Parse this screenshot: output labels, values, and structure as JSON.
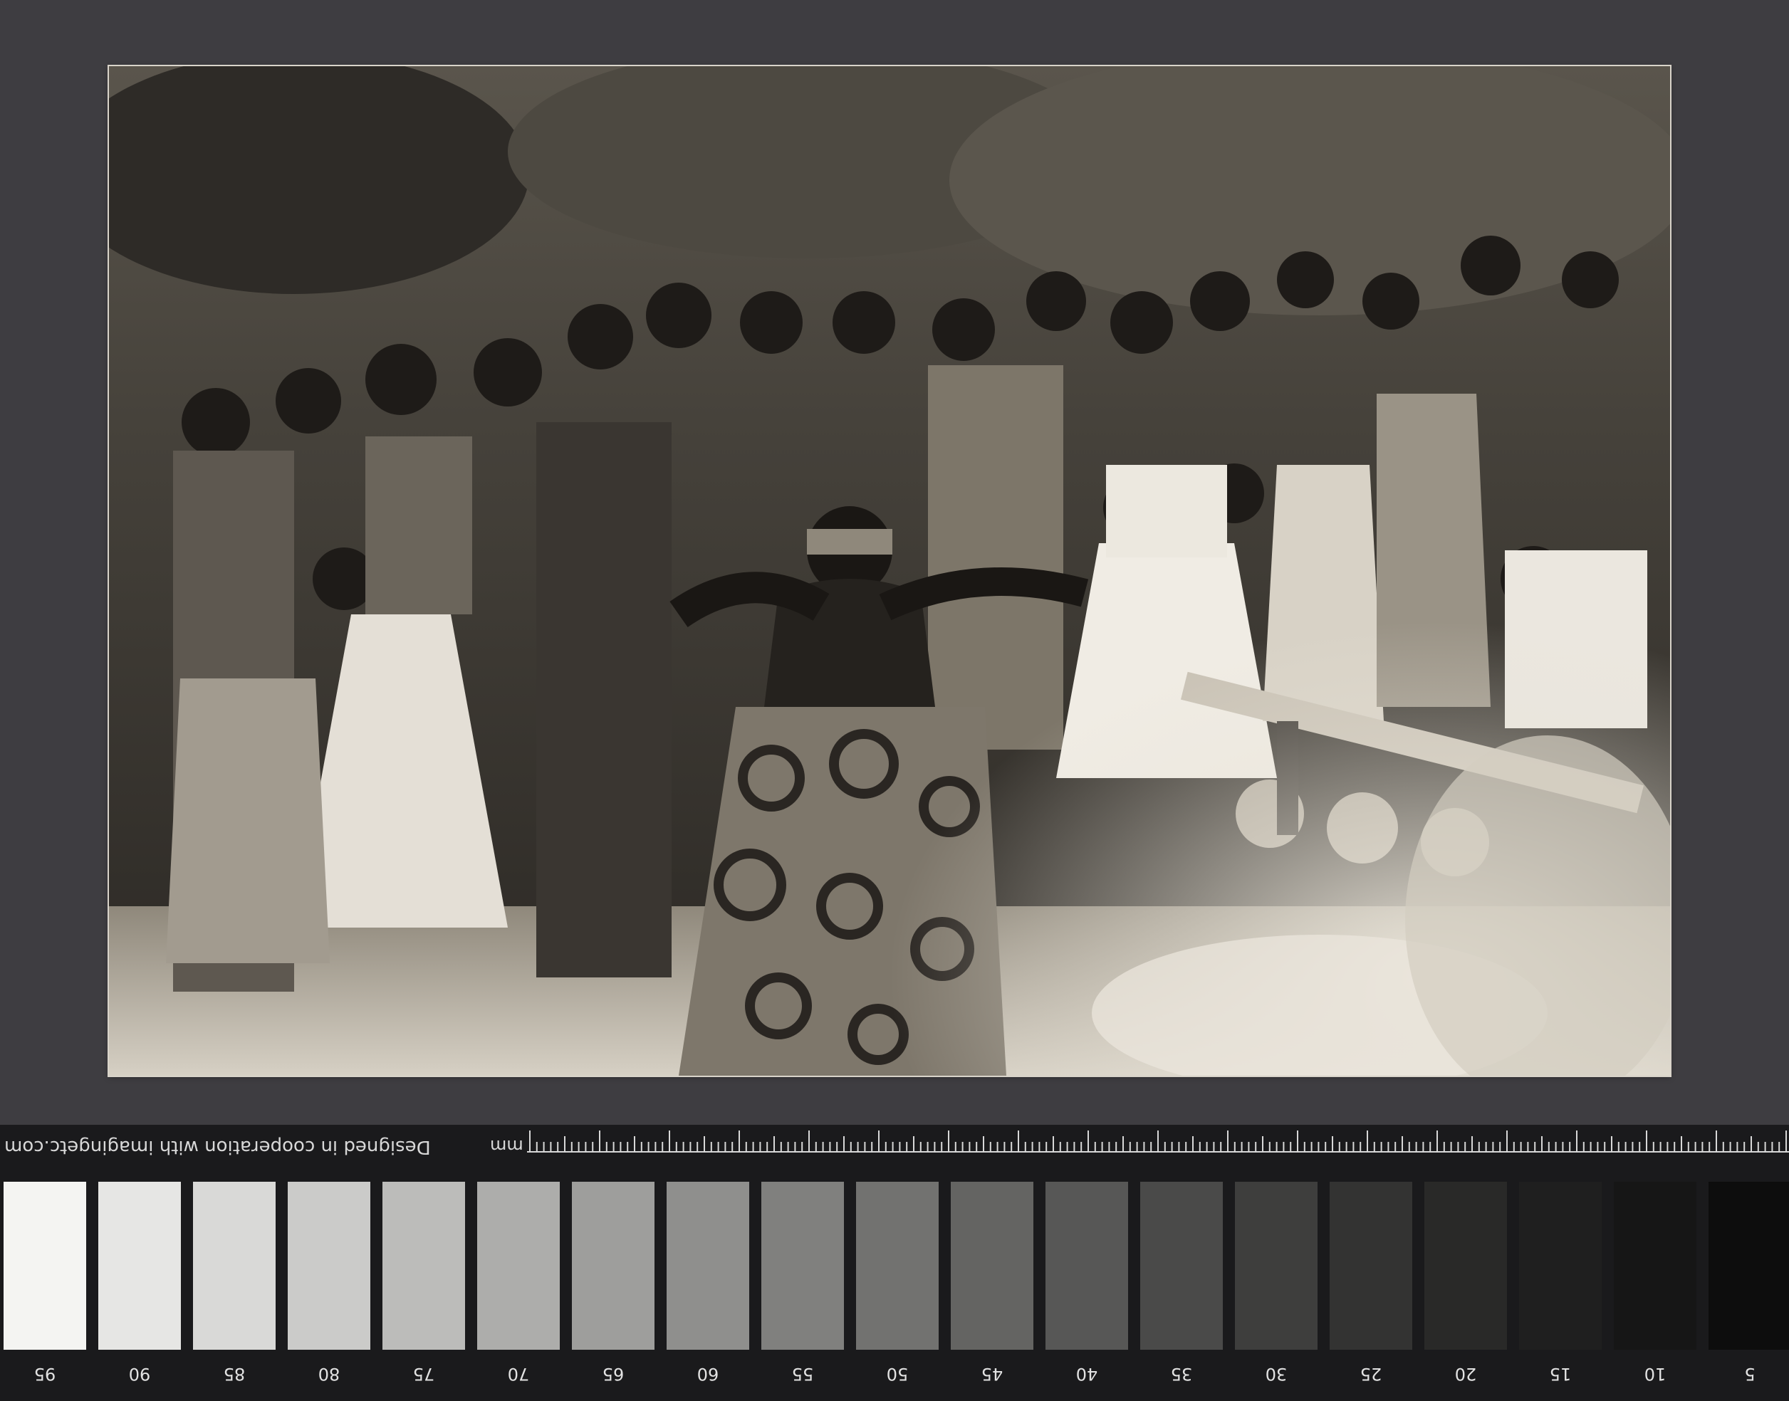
{
  "target": {
    "credit_text": "Designed in cooperation with imagingetc.com",
    "unit_label": "mm",
    "patches": [
      {
        "label": "95",
        "color": "#f4f4f2"
      },
      {
        "label": "90",
        "color": "#e6e6e4"
      },
      {
        "label": "85",
        "color": "#d9d9d7"
      },
      {
        "label": "80",
        "color": "#cbcbc9"
      },
      {
        "label": "75",
        "color": "#bcbcba"
      },
      {
        "label": "70",
        "color": "#adadab"
      },
      {
        "label": "65",
        "color": "#9e9e9c"
      },
      {
        "label": "60",
        "color": "#8f8f8d"
      },
      {
        "label": "55",
        "color": "#80807e"
      },
      {
        "label": "50",
        "color": "#727270"
      },
      {
        "label": "45",
        "color": "#646462"
      },
      {
        "label": "40",
        "color": "#575756"
      },
      {
        "label": "35",
        "color": "#4a4a49"
      },
      {
        "label": "30",
        "color": "#3e3e3d"
      },
      {
        "label": "25",
        "color": "#333332"
      },
      {
        "label": "20",
        "color": "#292928"
      },
      {
        "label": "15",
        "color": "#1f1f1f"
      },
      {
        "label": "10",
        "color": "#161616"
      },
      {
        "label": "5",
        "color": "#0d0d0d"
      }
    ]
  },
  "photo": {
    "subject": "black-and-white photograph of a dancer performing before a crowd of onlookers",
    "tone": "#b8b2a6"
  }
}
